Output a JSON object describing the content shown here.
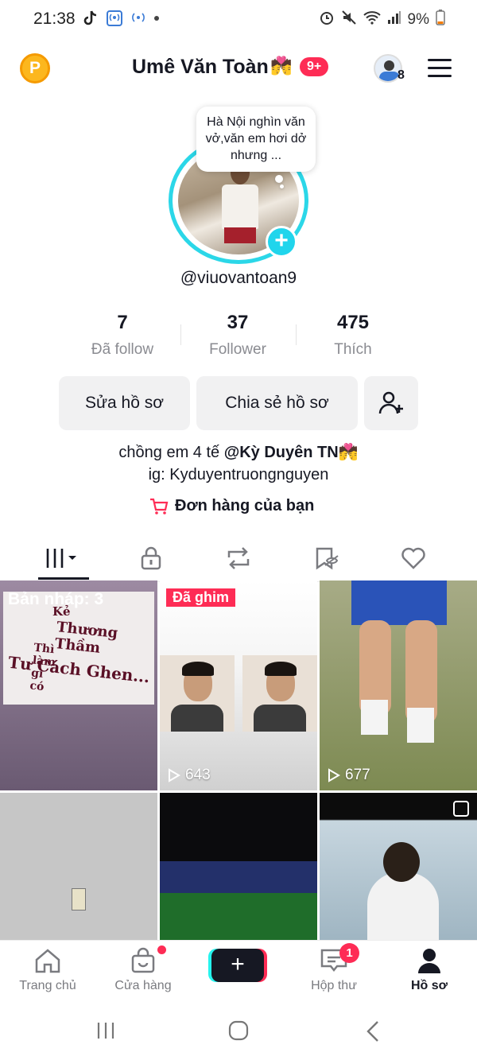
{
  "status_bar": {
    "time": "21:38",
    "battery": "9%"
  },
  "header": {
    "title": "Umê Văn Toàn",
    "title_emoji": "💏",
    "notification_badge": "9+",
    "account_count": "8",
    "coin_label": "P"
  },
  "profile": {
    "note": "Hà Nội nghìn văn vở,văn em hơi dở nhưng ...",
    "username": "@viuovantoan9"
  },
  "stats": [
    {
      "value": "7",
      "label": "Đã follow"
    },
    {
      "value": "37",
      "label": "Follower"
    },
    {
      "value": "475",
      "label": "Thích"
    }
  ],
  "actions": {
    "edit_profile": "Sửa hồ sơ",
    "share_profile": "Chia sẻ hồ sơ"
  },
  "bio": {
    "prefix": "chồng em 4 tế ",
    "mention": "@Kỳ Duyên TN",
    "emoji": "💏",
    "line2": "ig: Kyduyentruongnguyen",
    "orders_link": "Đơn hàng của bạn"
  },
  "videos": {
    "draft_label": "Bản nháp: 3",
    "draft_lines": [
      "Kẻ",
      "Thương Thầm",
      "Thì làm gì có",
      "Tư Cách Ghen..."
    ],
    "pinned_label": "Đã ghim",
    "pinned_views": "643",
    "third_views": "677"
  },
  "bottom_nav": {
    "home": "Trang chủ",
    "shop": "Cửa hàng",
    "inbox": "Hộp thư",
    "inbox_badge": "1",
    "profile": "Hồ sơ"
  },
  "colors": {
    "accent": "#fe2c55",
    "ring": "#2bd7e8",
    "text": "#161823",
    "muted": "#8a8b91"
  }
}
